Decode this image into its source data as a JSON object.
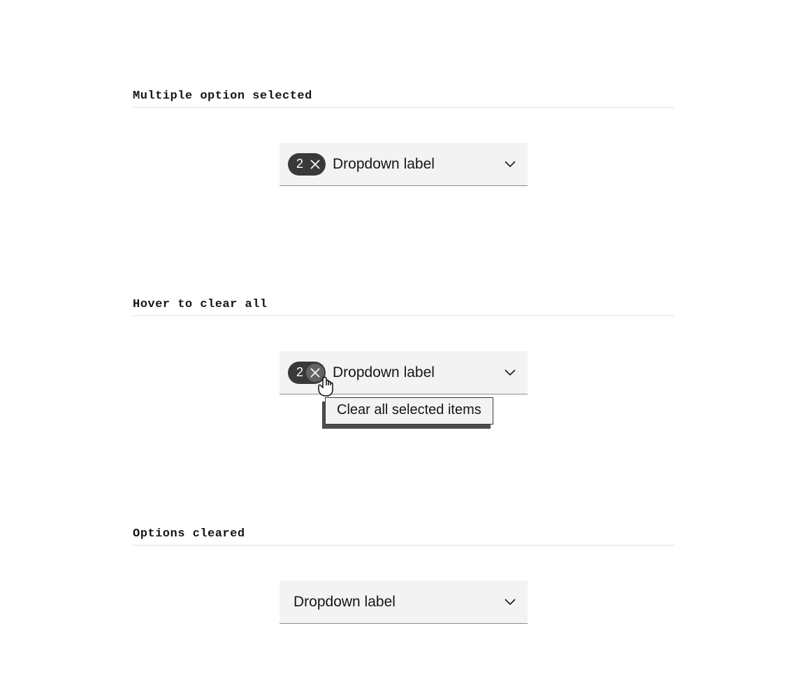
{
  "sections": [
    {
      "heading": "Multiple option selected"
    },
    {
      "heading": "Hover to clear all"
    },
    {
      "heading": "Options cleared"
    }
  ],
  "dropdown": {
    "label": "Dropdown label",
    "count": "2"
  },
  "tooltip": "Clear all selected items"
}
